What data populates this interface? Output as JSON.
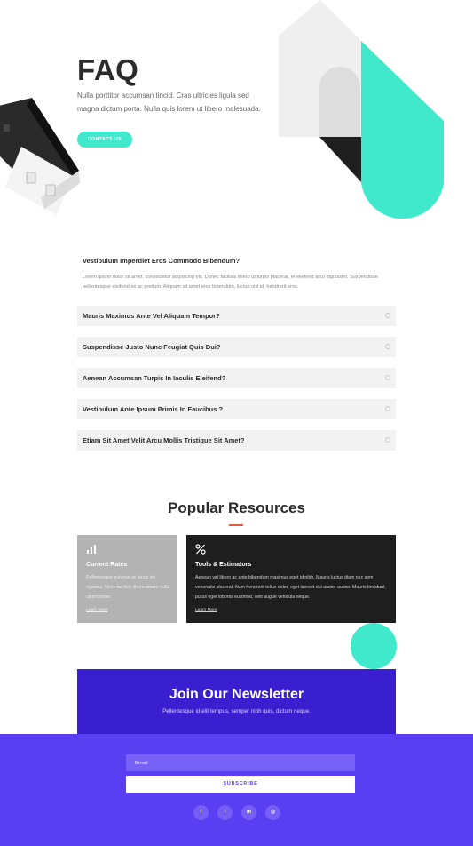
{
  "hero": {
    "title": "FAQ",
    "subtitle": "Nulla porttitor accumsan tincid. Cras ultricies ligula sed magna dictum porta. Nulla quis lorem ut libero malesuada.",
    "cta_label": "CONTACT US"
  },
  "faq": {
    "open_item": {
      "question": "Vestibulum Imperdiet Eros Commodo Bibendum?",
      "answer": "Lorem ipsum dolor sit amet, consectetur adipiscing elit. Donec facilisis libero ut turpis placerat, et eleifend arcu dignissim. Suspendisse pellentesque eleifend ex ac pretium. Aliquam sit amet eros bibendum, luctus nisl id, hendrerit eros."
    },
    "items": [
      {
        "question": "Mauris Maximus Ante Vel Aliquam Tempor?"
      },
      {
        "question": "Suspendisse Justo Nunc Feugiat Quis Dui?"
      },
      {
        "question": "Aenean Accumsan Turpis In Iaculis Eleifend?"
      },
      {
        "question": "Vestibulum Ante Ipsum Primis In Faucibus ?"
      },
      {
        "question": "Etiam Sit Amet Velit Arcu Mollis Tristique Sit Amet?"
      }
    ]
  },
  "resources": {
    "title": "Popular Resources",
    "cards": [
      {
        "icon": "bar-chart-icon",
        "title": "Current Rates",
        "text": "Pellentesque pulvinar ac lacus vel egestas. Nunc facilisis libero ornare nulla ullamcorper.",
        "link": "Learn More"
      },
      {
        "icon": "percent-icon",
        "title": "Tools & Estimators",
        "text": "Aenean vel libero ac ante bibendum maximus eget id nibh. Mauris luctus diam nec sem venenatis placerat. Nam hendrerit tellus dolor, eget laoreet dui auctor auctor. Mauris tincidunt, purus eget lobortis euismod, velit augue vehicula neque.",
        "link": "Learn More"
      }
    ]
  },
  "newsletter": {
    "title": "Join Our Newsletter",
    "subtitle": "Pellentesque id elit tempus, semper nibh quis, dictum neque.",
    "email_placeholder": "Email",
    "subscribe_label": "SUBSCRIBE"
  },
  "socials": [
    {
      "icon": "facebook-icon",
      "glyph": "f"
    },
    {
      "icon": "twitter-icon",
      "glyph": "t"
    },
    {
      "icon": "linkedin-icon",
      "glyph": "in"
    },
    {
      "icon": "instagram-icon",
      "glyph": "◎"
    }
  ],
  "colors": {
    "accent_teal": "#40e9cc",
    "brand_purple": "#5a3ef2",
    "newsletter_blue": "#3a1fd1",
    "divider_orange": "#e2603c"
  }
}
